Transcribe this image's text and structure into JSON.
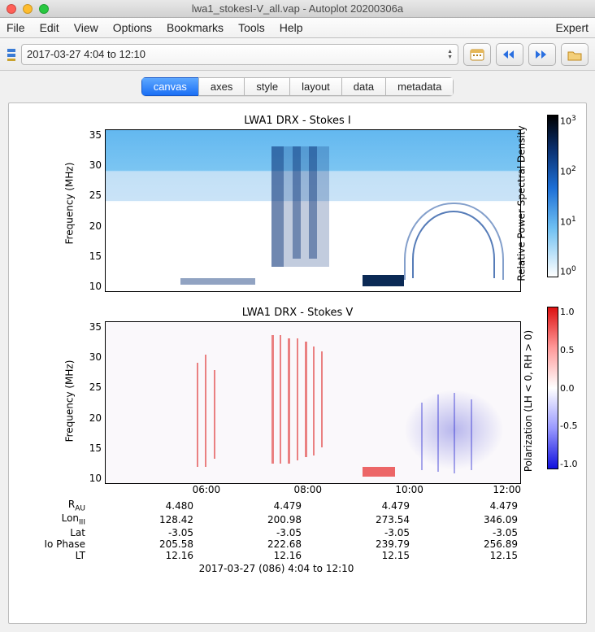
{
  "window": {
    "title": "lwa1_stokesI-V_all.vap - Autoplot 20200306a"
  },
  "menu": {
    "file": "File",
    "edit": "Edit",
    "view": "View",
    "options": "Options",
    "bookmarks": "Bookmarks",
    "tools": "Tools",
    "help": "Help",
    "expert": "Expert"
  },
  "toolbar": {
    "timerange_value": "2017-03-27 4:04 to 12:10"
  },
  "tabs": {
    "canvas": "canvas",
    "axes": "axes",
    "style": "style",
    "layout": "layout",
    "data": "data",
    "metadata": "metadata",
    "active": "canvas"
  },
  "chart_data": [
    {
      "type": "heatmap",
      "title": "LWA1 DRX - Stokes I",
      "ylabel": "Frequency (MHz)",
      "ylim": [
        10,
        38
      ],
      "yticks": [
        10,
        15,
        20,
        25,
        30,
        35
      ],
      "xlabel": "",
      "colorbar": {
        "label": "Relative Power Spectral Density",
        "ticks": [
          "10^3",
          "10^2",
          "10^1",
          "10^0"
        ],
        "scale": "log"
      }
    },
    {
      "type": "heatmap",
      "title": "LWA1 DRX - Stokes V",
      "ylabel": "Frequency (MHz)",
      "ylim": [
        10,
        38
      ],
      "yticks": [
        10,
        15,
        20,
        25,
        30,
        35
      ],
      "xlabel": "",
      "colorbar": {
        "label": "Polarization (LH < 0, RH > 0)",
        "ticks": [
          "1.0",
          "0.5",
          "0.0",
          "-0.5",
          "-1.0"
        ],
        "range": [
          -1,
          1
        ]
      }
    }
  ],
  "xaxis": {
    "times": [
      "06:00",
      "08:00",
      "10:00",
      "12:00"
    ],
    "ephemeris_rows": [
      {
        "label": "R_AU",
        "values": [
          "4.480",
          "4.479",
          "4.479",
          "4.479"
        ]
      },
      {
        "label": "Lon_III",
        "values": [
          "128.42",
          "200.98",
          "273.54",
          "346.09"
        ]
      },
      {
        "label": "Lat",
        "values": [
          "-3.05",
          "-3.05",
          "-3.05",
          "-3.05"
        ]
      },
      {
        "label": "Io Phase",
        "values": [
          "205.58",
          "222.68",
          "239.79",
          "256.89"
        ]
      },
      {
        "label": "LT",
        "values": [
          "12.16",
          "12.16",
          "12.15",
          "12.15"
        ]
      }
    ],
    "caption": "2017-03-27 (086) 4:04 to 12:10"
  }
}
